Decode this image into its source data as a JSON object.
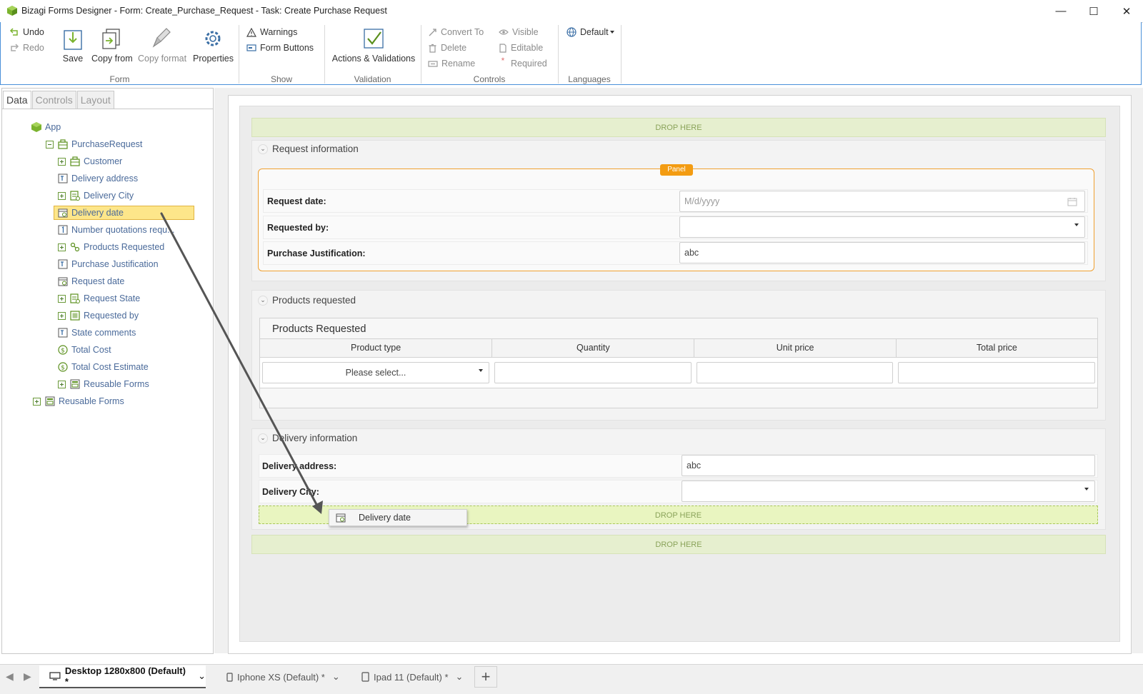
{
  "window": {
    "title": "Bizagi Forms Designer  - Form: Create_Purchase_Request - Task:  Create Purchase Request",
    "controls": {
      "minimize": "—",
      "maximize": "☐",
      "close": "✕"
    }
  },
  "ribbon": {
    "form_group": {
      "label": "Form",
      "undo": "Undo",
      "redo": "Redo",
      "save": "Save",
      "copy_from": "Copy from",
      "copy_format": "Copy format",
      "properties": "Properties"
    },
    "show_group": {
      "label": "Show",
      "warnings": "Warnings",
      "form_buttons": "Form Buttons"
    },
    "validation_group": {
      "label": "Validation",
      "actions": "Actions & Validations"
    },
    "controls_group": {
      "label": "Controls",
      "convert_to": "Convert To",
      "delete": "Delete",
      "rename": "Rename",
      "visible": "Visible",
      "editable": "Editable",
      "required": "Required"
    },
    "languages_group": {
      "label": "Languages",
      "default": "Default"
    }
  },
  "left_tabs": {
    "data": "Data",
    "controls": "Controls",
    "layout": "Layout"
  },
  "tree": {
    "app": "App",
    "purchase_request": "PurchaseRequest",
    "items": [
      {
        "label": "Customer"
      },
      {
        "label": "Delivery address"
      },
      {
        "label": "Delivery City"
      },
      {
        "label": "Delivery date"
      },
      {
        "label": "Number quotations requ..."
      },
      {
        "label": "Products Requested"
      },
      {
        "label": "Purchase Justification"
      },
      {
        "label": "Request date"
      },
      {
        "label": "Request State"
      },
      {
        "label": "Requested by"
      },
      {
        "label": "State comments"
      },
      {
        "label": "Total Cost"
      },
      {
        "label": "Total Cost Estimate"
      },
      {
        "label": "Reusable Forms"
      }
    ],
    "root_reusable": "Reusable Forms"
  },
  "canvas": {
    "drop_here": "DROP HERE",
    "request_group": {
      "title": "Request information",
      "panel_badge": "Panel",
      "fields": [
        {
          "label": "Request date:",
          "value": "M/d/yyyy"
        },
        {
          "label": "Requested by:",
          "value": ""
        },
        {
          "label": "Purchase Justification:",
          "value": "abc"
        }
      ]
    },
    "products_group": {
      "title": "Products requested",
      "grid_title": "Products Requested",
      "columns": [
        "Product type",
        "Quantity",
        "Unit price",
        "Total price"
      ],
      "first_cell": "Please select..."
    },
    "delivery_group": {
      "title": "Delivery information",
      "fields": [
        {
          "label": "Delivery address:",
          "value": "abc"
        },
        {
          "label": "Delivery City:",
          "value": ""
        }
      ],
      "drag_item": "Delivery date"
    }
  },
  "bottom": {
    "tabs": [
      {
        "label": "Desktop 1280x800 (Default) *"
      },
      {
        "label": "Iphone XS (Default) *"
      },
      {
        "label": "Ipad 11 (Default) *"
      }
    ],
    "add": "+"
  },
  "colors": {
    "accent": "#4a90d9",
    "panel_border": "#f0a030",
    "badge": "#f39c12",
    "selection": "#fde68a"
  }
}
